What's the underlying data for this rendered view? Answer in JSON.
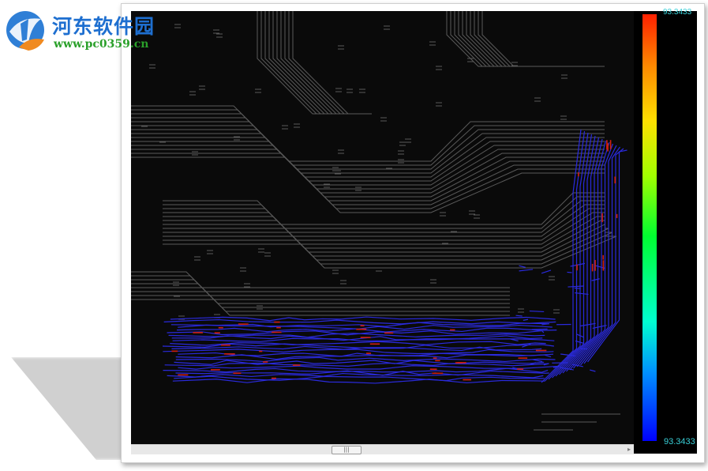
{
  "watermark": {
    "title": "河东软件园",
    "url": "www.pc0359.cn"
  },
  "color_scale": {
    "max_label": "93.3433",
    "min_label": "93.3433",
    "colors": [
      "#ff2000",
      "#ff8800",
      "#ffe000",
      "#a0ff00",
      "#00ff30",
      "#00ffd0",
      "#0090ff",
      "#0000ff"
    ]
  },
  "scrollbar": {
    "thumb_grip": "|||"
  },
  "colors": {
    "background": "#0a0a0a",
    "trace_gray": "#5a5a5a",
    "trace_blue": "#2a2adc",
    "trace_red": "#d02010",
    "label_cyan": "#39d0d8"
  }
}
